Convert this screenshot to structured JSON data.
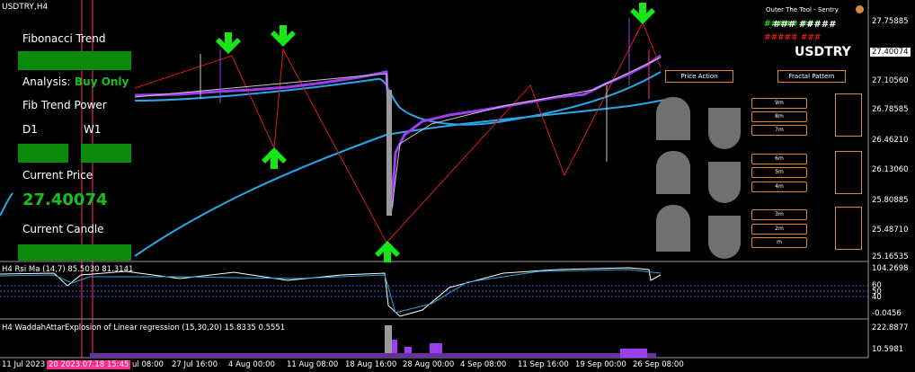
{
  "window": {
    "symbol_title": "USDTRY,H4"
  },
  "panel": {
    "fib_trend_label": "Fibonacci Trend",
    "analysis_label": "Analysis:",
    "analysis_value": "Buy Only",
    "fib_power_label": "Fib Trend Power",
    "tf1": "D1",
    "tf2": "W1",
    "current_price_label": "Current Price",
    "current_price_value": "27.40074",
    "current_candle_label": "Current Candle"
  },
  "header_right": {
    "brand": "Outer The Tool - Sentry",
    "hash_row1": "##### ###",
    "hash_row2": "### #####",
    "hash_row3": "##### ###",
    "symbol_big": "USDTRY"
  },
  "buttons": {
    "price_action": "Price Action",
    "fractal_pattern": "Fractal Pattern",
    "timeframes_col": [
      "9m",
      "8m",
      "7m",
      "6m",
      "5m",
      "4m",
      "3m",
      "2m",
      "m"
    ]
  },
  "price_axis": {
    "labels": [
      "27.75885",
      "27.40074",
      "27.10560",
      "26.78585",
      "26.46210",
      "26.13060",
      "25.80885",
      "25.48710",
      "25.16535"
    ],
    "current": "27.40074"
  },
  "rsi": {
    "title": "H4  Rsi Ma (14,7) 85.5030 81.3141",
    "axis": [
      "104.2698",
      "60",
      "50",
      "40",
      "-0.0456"
    ]
  },
  "waddah": {
    "title": "H4  WaddahAttarExplosion of Linear regression (15,30,20) 15.8335 0.5551",
    "axis": [
      "222.8877",
      "10.5981"
    ]
  },
  "time_axis": {
    "labels": [
      "11 Jul 2023",
      "20 2023.07.18 15:45",
      "ul 08:00",
      "27 Jul 16:00",
      "4 Aug 00:00",
      "11 Aug 08:00",
      "18 Aug 16:00",
      "28 Aug 00:00",
      "4 Sep 08:00",
      "11 Sep 16:00",
      "19 Sep 00:00",
      "26 Sep 08:00"
    ]
  },
  "colors": {
    "green": "#0c8a0c",
    "arrow_green": "#19e619",
    "ma_blue": "#2aa6e6",
    "candle_purple": "#9b3ef0",
    "zigzag_red": "#e11a1a",
    "accent_orange": "#d68a3c"
  }
}
